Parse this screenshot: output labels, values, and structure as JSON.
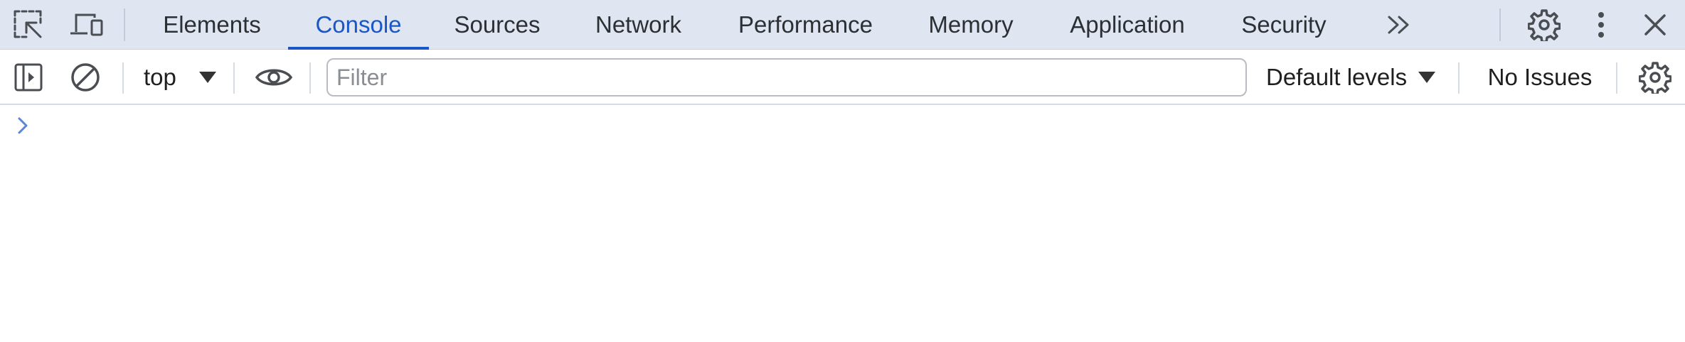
{
  "tabbar": {
    "tabs": [
      {
        "label": "Elements",
        "active": false
      },
      {
        "label": "Console",
        "active": true
      },
      {
        "label": "Sources",
        "active": false
      },
      {
        "label": "Network",
        "active": false
      },
      {
        "label": "Performance",
        "active": false
      },
      {
        "label": "Memory",
        "active": false
      },
      {
        "label": "Application",
        "active": false
      },
      {
        "label": "Security",
        "active": false
      }
    ],
    "icons": {
      "inspect": "inspect-element-icon",
      "device": "device-toolbar-icon",
      "more_tabs": "chevron-double-right-icon",
      "settings": "gear-icon",
      "menu": "kebab-menu-icon",
      "close": "close-icon"
    }
  },
  "toolbar": {
    "context": "top",
    "filter_placeholder": "Filter",
    "filter_value": "",
    "levels_label": "Default levels",
    "issues_label": "No Issues",
    "icons": {
      "sidebar": "sidebar-toggle-icon",
      "clear": "clear-console-icon",
      "live_expression": "eye-icon",
      "settings": "gear-icon"
    }
  },
  "colors": {
    "tabbar_bg": "#dfe5f1",
    "accent": "#1a57c6",
    "prompt": "#5a86d6"
  }
}
